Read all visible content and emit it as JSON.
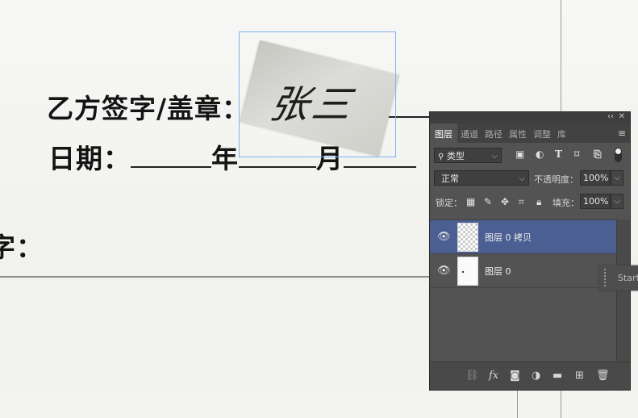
{
  "document": {
    "sign_label": "乙方签字/盖章：",
    "date_label": "日期：",
    "year_char": "年",
    "month_char": "月",
    "left_fragment": "字：",
    "signature_text": "张三"
  },
  "layers_panel": {
    "tabs": [
      "图层",
      "通道",
      "路径",
      "属性",
      "调整",
      "库"
    ],
    "active_tab": "图层",
    "filter_type": "类型",
    "blend_mode": "正常",
    "opacity_label": "不透明度：",
    "opacity_value": "100%",
    "lock_label": "锁定：",
    "fill_label": "填充：",
    "fill_value": "100%",
    "layers": [
      {
        "name": "图层 0 拷贝",
        "selected": true,
        "thumb": "transparent"
      },
      {
        "name": "图层 0",
        "selected": false,
        "thumb": "white"
      }
    ],
    "accent_color": "#4b5f92"
  },
  "side_tab": {
    "label": "Start"
  }
}
